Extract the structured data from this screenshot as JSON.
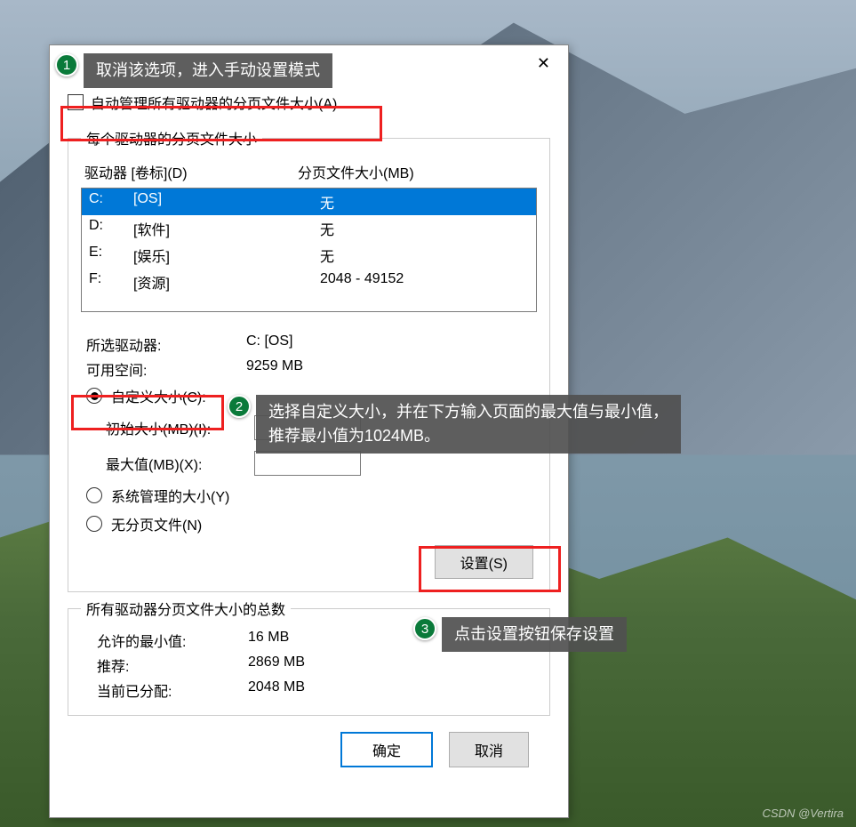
{
  "checkbox_label": "自动管理所有驱动器的分页文件大小(A)",
  "group1_title": "每个驱动器的分页文件大小",
  "drive_header": {
    "col1": "驱动器 [卷标](D)",
    "col2": "分页文件大小(MB)"
  },
  "drives": [
    {
      "letter": "C:",
      "label": "[OS]",
      "size": "无",
      "selected": true
    },
    {
      "letter": "D:",
      "label": "[软件]",
      "size": "无",
      "selected": false
    },
    {
      "letter": "E:",
      "label": "[娱乐]",
      "size": "无",
      "selected": false
    },
    {
      "letter": "F:",
      "label": "[资源]",
      "size": "2048 - 49152",
      "selected": false
    }
  ],
  "selected_drive_label": "所选驱动器:",
  "selected_drive_value": "C:  [OS]",
  "free_space_label": "可用空间:",
  "free_space_value": "9259 MB",
  "radio_custom": "自定义大小(C):",
  "initial_size_label": "初始大小(MB)(I):",
  "initial_size_value": "",
  "max_size_label": "最大值(MB)(X):",
  "max_size_value": "",
  "radio_system": "系统管理的大小(Y)",
  "radio_none": "无分页文件(N)",
  "set_button": "设置(S)",
  "group2_title": "所有驱动器分页文件大小的总数",
  "min_allowed_label": "允许的最小值:",
  "min_allowed_value": "16 MB",
  "recommended_label": "推荐:",
  "recommended_value": "2869 MB",
  "allocated_label": "当前已分配:",
  "allocated_value": "2048 MB",
  "ok_button": "确定",
  "cancel_button": "取消",
  "callouts": {
    "c1": "取消该选项，进入手动设置模式",
    "c2": "选择自定义大小，并在下方输入页面的最大值与最小值，\n推荐最小值为1024MB。",
    "c3": "点击设置按钮保存设置"
  },
  "watermark": "CSDN @Vertira"
}
